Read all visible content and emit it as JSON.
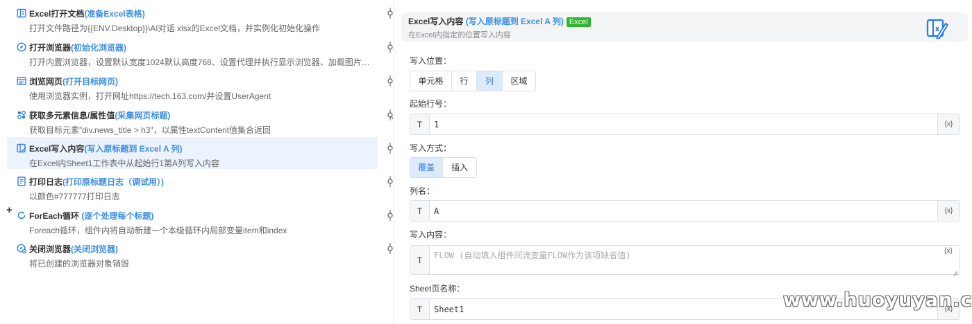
{
  "steps": [
    {
      "name": "Excel打开文档",
      "alias": "(准备Excel表格)",
      "desc": "打开文件路径为{{ENV.Desktop}}\\AI对话.xlsx的Excel文档，并实例化初始化操作",
      "icon": "excel-open-icon"
    },
    {
      "name": "打开浏览器",
      "alias": "(初始化浏览器)",
      "desc": "打开内置浏览器，设置默认宽度1024默认高度768、设置代理并执行显示浏览器、加载图片、…",
      "icon": "browser-compass-icon"
    },
    {
      "name": "浏览网页",
      "alias": "(打开目标网页)",
      "desc": "使用浏览器实例，打开网址https://tech.163.com/并设置UserAgent",
      "icon": "webpage-icon"
    },
    {
      "name": "获取多元素信息/属性值",
      "alias": "(采集网页标题)",
      "desc": "获取目标元素\"div.news_title > h3\"，以属性textContent值集合返回",
      "icon": "collect-elements-icon"
    },
    {
      "name": "Excel写入内容",
      "alias": "(写入原标题到 Excel A 列)",
      "desc": "在Excel内Sheet1工作表中从起始行1第A列写入内容",
      "icon": "excel-write-icon"
    },
    {
      "name": "打印日志",
      "alias": "(打印原标题日志（调试用）)",
      "desc": "以颜色#777777打印日志",
      "icon": "print-log-icon"
    },
    {
      "name": "ForEach循环",
      "alias": " (逐个处理每个标题)",
      "desc": "Foreach循环，组件内将自动新建一个本级循环内局部变量item和index",
      "icon": "loop-icon"
    },
    {
      "name": "关闭浏览器",
      "alias": "(关闭浏览器)",
      "desc": "将已创建的浏览器对象销毁",
      "icon": "close-browser-icon"
    }
  ],
  "panel": {
    "title": "Excel写入内容",
    "alias": " (写入原标题到 Excel A 列)",
    "badge": "Excel",
    "subtitle": "在Excel内指定的位置写入内容",
    "position_label": "写入位置：",
    "position_options": [
      "单元格",
      "行",
      "列",
      "区域"
    ],
    "position_selected": "列",
    "start_row_label": "起始行号：",
    "start_row_value": "1",
    "mode_label": "写入方式：",
    "mode_options": [
      "覆盖",
      "插入"
    ],
    "mode_selected": "覆盖",
    "column_label": "列名：",
    "column_value": "A",
    "content_label": "写入内容：",
    "content_placeholder": "FLOW (自动填入组件间流变量FLOW作为该项缺省值)",
    "sheet_label": "Sheet页名称：",
    "sheet_value": "Sheet1",
    "type_tag": "T",
    "var_button": "{x}"
  },
  "watermark": "www.huoyuyan.com",
  "colors": {
    "accent": "#3b8ee3",
    "badge": "#2fb52f",
    "selected_row": "#edf3fd",
    "selected_option": "#dcebfc"
  }
}
